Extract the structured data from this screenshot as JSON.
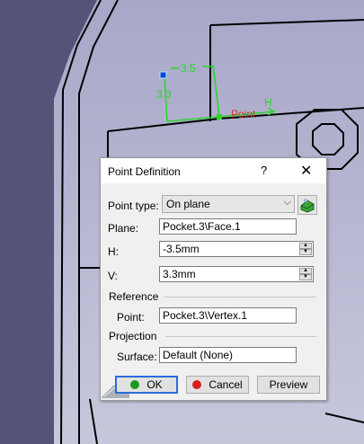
{
  "sketch": {
    "h_dim": "3.5",
    "v_dim": "3.3",
    "point_label": "Point",
    "h_axis_label": "H"
  },
  "dialog": {
    "title": "Point Definition",
    "help": "?",
    "close": "✕",
    "point_type_label": "Point type:",
    "point_type_value": "On plane",
    "plane_label": "Plane:",
    "plane_value": "Pocket.3\\Face.1",
    "h_label": "H:",
    "h_value": "-3.5mm",
    "v_label": "V:",
    "v_value": "3.3mm",
    "reference_title": "Reference",
    "ref_point_label": "Point:",
    "ref_point_value": "Pocket.3\\Vertex.1",
    "projection_title": "Projection",
    "surface_label": "Surface:",
    "surface_value": "Default (None)",
    "ok_label": "OK",
    "cancel_label": "Cancel",
    "preview_label": "Preview"
  },
  "colors": {
    "background": "#b7b7d0",
    "dark_background": "#545478",
    "sketch_green": "#2ad62a",
    "point_red": "#d83a3a",
    "point_blue": "#1e3fd8",
    "ok_dot": "#1a9a1a",
    "cancel_dot": "#d42020"
  }
}
